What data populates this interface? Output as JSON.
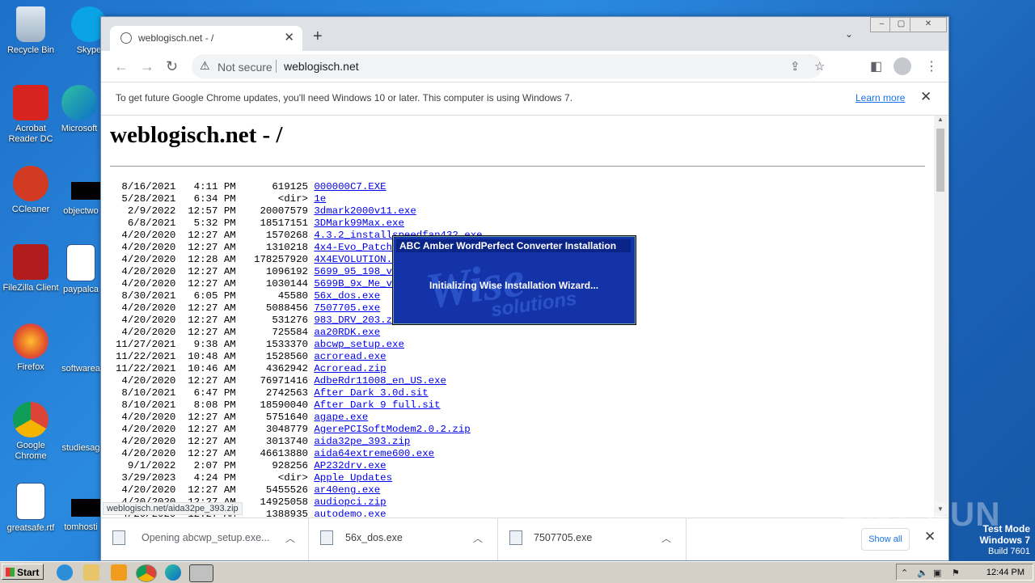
{
  "desktop_icons": [
    {
      "name": "recycle-bin",
      "label": "Recycle Bin"
    },
    {
      "name": "skype",
      "label": "Skype"
    },
    {
      "name": "acrobat",
      "label": "Acrobat Reader DC"
    },
    {
      "name": "microsoft-edge",
      "label": "Microsoft"
    },
    {
      "name": "ccleaner",
      "label": "CCleaner"
    },
    {
      "name": "objectwo",
      "label": "objectwo"
    },
    {
      "name": "filezilla",
      "label": "FileZilla Client"
    },
    {
      "name": "paypalca",
      "label": "paypalca"
    },
    {
      "name": "firefox",
      "label": "Firefox"
    },
    {
      "name": "softwarea",
      "label": "softwarea"
    },
    {
      "name": "google-chrome",
      "label": "Google Chrome"
    },
    {
      "name": "studiesag",
      "label": "studiesag"
    },
    {
      "name": "greatsafe",
      "label": "greatsafe.rtf"
    },
    {
      "name": "tomhosti",
      "label": "tomhosti"
    }
  ],
  "browser": {
    "tab_title": "weblogisch.net - /",
    "not_secure": "Not secure",
    "url": "weblogisch.net",
    "infobar_msg": "To get future Google Chrome updates, you'll need Windows 10 or later. This computer is using Windows 7.",
    "learn_more": "Learn more",
    "status_link": "weblogisch.net/aida32pe_393.zip"
  },
  "page": {
    "heading": "weblogisch.net - /",
    "rows": [
      {
        "date": " 8/16/2021",
        "time": " 4:11 PM",
        "size": "   619125",
        "name": "000000C7.EXE"
      },
      {
        "date": " 5/28/2021",
        "time": " 6:34 PM",
        "size": "    <dir>",
        "name": "1e"
      },
      {
        "date": "  2/9/2022",
        "time": "12:57 PM",
        "size": " 20007579",
        "name": "3dmark2000v11.exe"
      },
      {
        "date": "  6/8/2021",
        "time": " 5:32 PM",
        "size": " 18517151",
        "name": "3DMark99Max.exe"
      },
      {
        "date": " 4/20/2020",
        "time": "12:27 AM",
        "size": "  1570268",
        "name": "4.3.2_installspeedfan432.exe"
      },
      {
        "date": " 4/20/2020",
        "time": "12:27 AM",
        "size": "  1310218",
        "name": "4x4-Evo_Patch_Win"
      },
      {
        "date": " 4/20/2020",
        "time": "12:28 AM",
        "size": "178257920",
        "name": "4X4EVOLUTION.iso"
      },
      {
        "date": " 4/20/2020",
        "time": "12:27 AM",
        "size": "  1096192",
        "name": "5699_95_198_v92up"
      },
      {
        "date": " 4/20/2020",
        "time": "12:27 AM",
        "size": "  1030144",
        "name": "5699B_9x_Me_v198."
      },
      {
        "date": " 8/30/2021",
        "time": " 6:05 PM",
        "size": "    45580",
        "name": "56x_dos.exe"
      },
      {
        "date": " 4/20/2020",
        "time": "12:27 AM",
        "size": "  5088456",
        "name": "7507705.exe"
      },
      {
        "date": " 4/20/2020",
        "time": "12:27 AM",
        "size": "   531276",
        "name": "983_DRV_203.zip"
      },
      {
        "date": " 4/20/2020",
        "time": "12:27 AM",
        "size": "   725584",
        "name": "aa20RDK.exe"
      },
      {
        "date": "11/27/2021",
        "time": " 9:38 AM",
        "size": "  1533370",
        "name": "abcwp_setup.exe"
      },
      {
        "date": "11/22/2021",
        "time": "10:48 AM",
        "size": "  1528560",
        "name": "acroread.exe"
      },
      {
        "date": "11/22/2021",
        "time": "10:46 AM",
        "size": "  4362942",
        "name": "Acroread.zip"
      },
      {
        "date": " 4/20/2020",
        "time": "12:27 AM",
        "size": " 76971416",
        "name": "AdbeRdr11008_en_US.exe"
      },
      {
        "date": " 8/10/2021",
        "time": " 6:47 PM",
        "size": "  2742563",
        "name": "After Dark 3.0d.sit"
      },
      {
        "date": " 8/10/2021",
        "time": " 8:08 PM",
        "size": " 18590040",
        "name": "After Dark 9 full.sit"
      },
      {
        "date": " 4/20/2020",
        "time": "12:27 AM",
        "size": "  5751640",
        "name": "agape.exe"
      },
      {
        "date": " 4/20/2020",
        "time": "12:27 AM",
        "size": "  3048779",
        "name": "AgerePCISoftModem2.0.2.zip"
      },
      {
        "date": " 4/20/2020",
        "time": "12:27 AM",
        "size": "  3013740",
        "name": "aida32pe_393.zip"
      },
      {
        "date": " 4/20/2020",
        "time": "12:27 AM",
        "size": " 46613880",
        "name": "aida64extreme600.exe"
      },
      {
        "date": "  9/1/2022",
        "time": " 2:07 PM",
        "size": "   928256",
        "name": "AP232drv.exe"
      },
      {
        "date": " 3/29/2023",
        "time": " 4:24 PM",
        "size": "    <dir>",
        "name": "Apple Updates"
      },
      {
        "date": " 4/20/2020",
        "time": "12:27 AM",
        "size": "  5455526",
        "name": "ar40eng.exe"
      },
      {
        "date": " 4/20/2020",
        "time": "12:27 AM",
        "size": " 14925058",
        "name": "audiopci.zip"
      },
      {
        "date": " 4/20/2020",
        "time": "12:27 AM",
        "size": "  1388935",
        "name": "autodemo.exe"
      }
    ]
  },
  "downloads": [
    {
      "label": "Opening abcwp_setup.exe..."
    },
    {
      "label": "56x_dos.exe"
    },
    {
      "label": "7507705.exe"
    }
  ],
  "show_all": "Show all",
  "wise_dialog": {
    "title": "ABC Amber WordPerfect Converter Installation",
    "message": "Initializing Wise Installation Wizard...",
    "bg_word": "Wise",
    "bg_word2": "solutions"
  },
  "watermark": "ANY RUN",
  "test_mode": {
    "line1": "Test Mode",
    "line2": "Windows 7",
    "line3": "Build 7601"
  },
  "taskbar": {
    "start": "Start",
    "clock": "12:44 PM"
  }
}
